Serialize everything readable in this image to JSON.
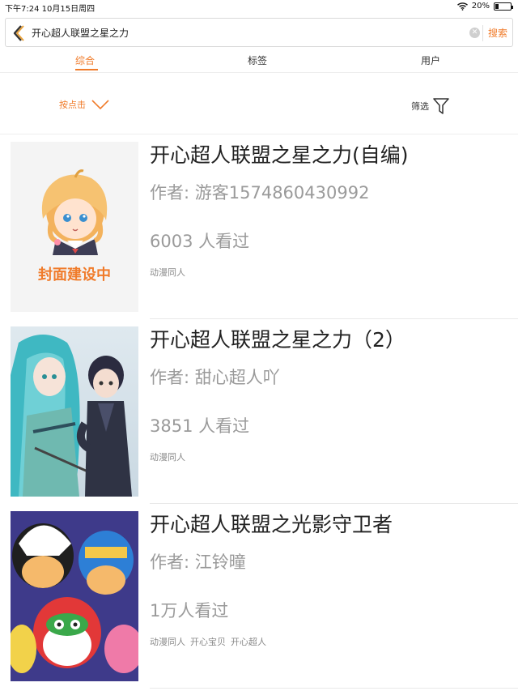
{
  "status_bar": {
    "time": "下午7:24",
    "date": "10月15日周四",
    "battery": "20%",
    "battery_level": 0.2,
    "wifi_icon": "wifi-icon"
  },
  "search": {
    "query": "开心超人联盟之星之力",
    "button_label": "搜索",
    "back_icon": "chevron-left-icon",
    "clear_icon": "clear-icon"
  },
  "tabs": [
    {
      "label": "综合",
      "active": true
    },
    {
      "label": "标签",
      "active": false
    },
    {
      "label": "用户",
      "active": false
    }
  ],
  "filter_bar": {
    "sort_label": "按点击",
    "sort_icon": "chevron-down-icon",
    "filter_label": "筛选",
    "filter_icon": "funnel-icon"
  },
  "accent_color": "#f07b2a",
  "results": [
    {
      "title": "开心超人联盟之星之力(自编)",
      "author": "作者: 游客1574860430992",
      "views": "6003 人看过",
      "tags": [
        "动漫同人"
      ],
      "cover": {
        "kind": "placeholder",
        "caption": "封面建设中"
      }
    },
    {
      "title": "开心超人联盟之星之力（2）",
      "author": "作者: 甜心超人吖",
      "views": "3851 人看过",
      "tags": [
        "动漫同人"
      ],
      "cover": {
        "kind": "anime-characters-illustration"
      }
    },
    {
      "title": "开心超人联盟之光影守卫者",
      "author": "作者: 江铃曈",
      "views": "1万人看过",
      "tags": [
        "动漫同人",
        "开心宝贝",
        "开心超人"
      ],
      "cover": {
        "kind": "cartoon-heroes-illustration"
      }
    }
  ]
}
